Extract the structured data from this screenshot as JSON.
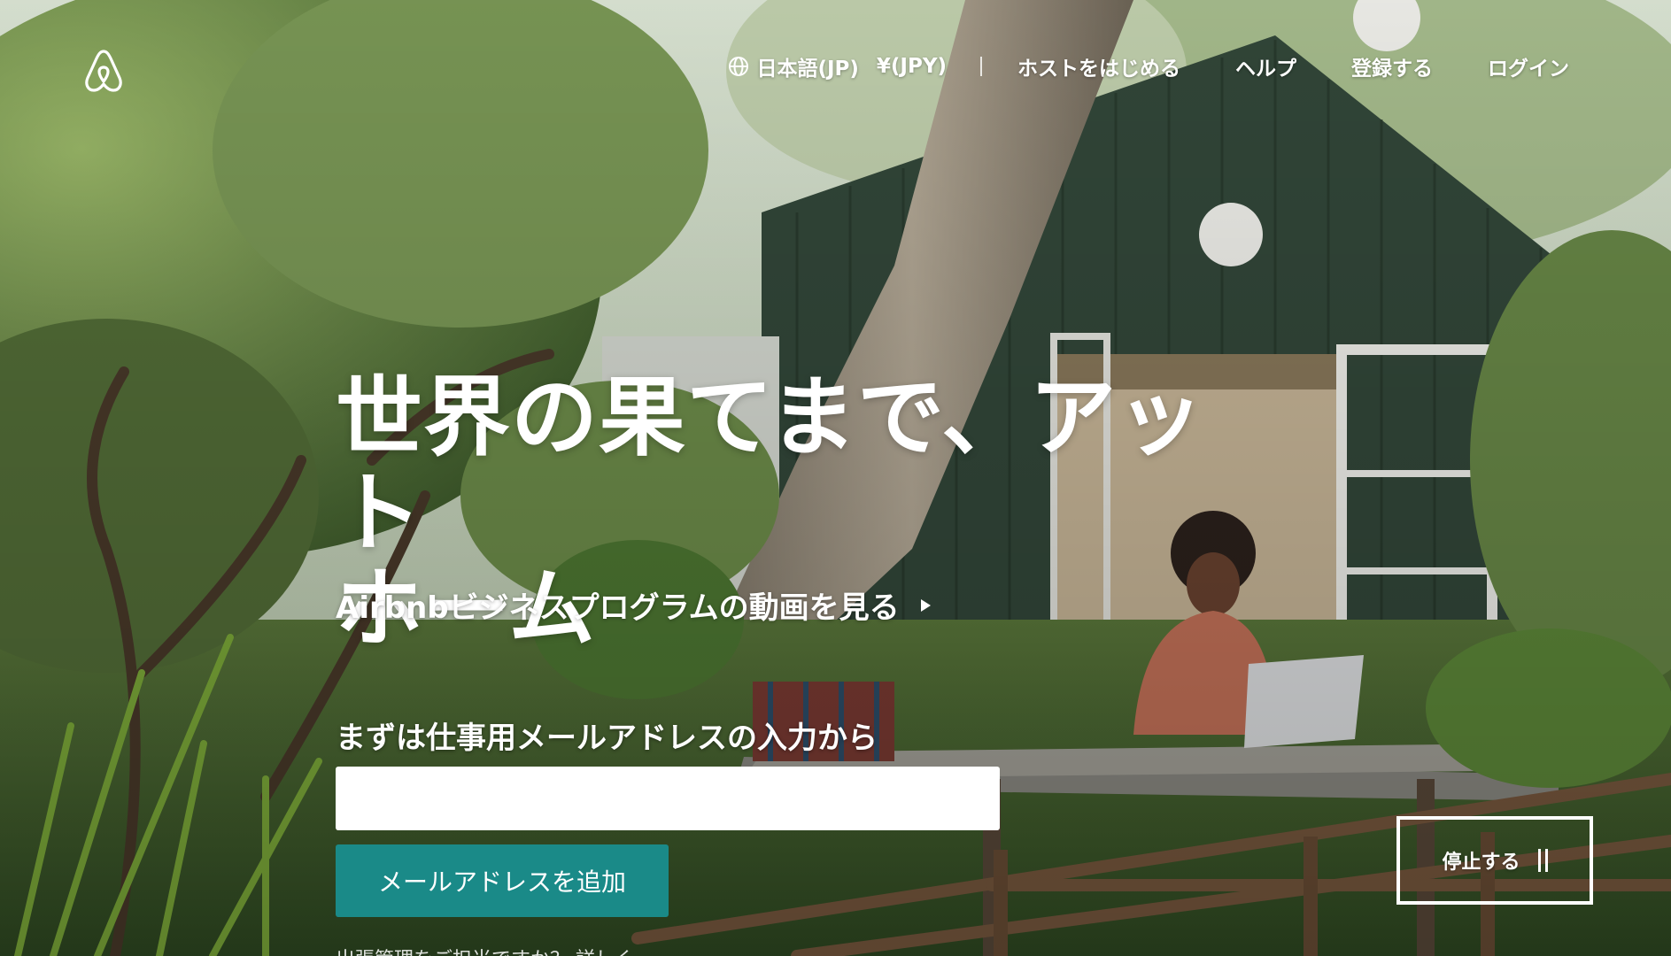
{
  "nav": {
    "language": "日本語(JP)",
    "currency": "¥(JPY)",
    "host": "ホストをはじめる",
    "help": "ヘルプ",
    "signup": "登録する",
    "login": "ログイン"
  },
  "hero": {
    "title_line1": "世界の果てまで、アット",
    "title_line2": "ホーム",
    "video_link": "Airbnbビジネスプログラムの動画を見る"
  },
  "signup_form": {
    "label": "まずは仕事用メールアドレスの入力から",
    "email_value": "",
    "email_placeholder": "",
    "submit_label": "メールアドレスを追加",
    "fine_print": "出張管理をご担当ですか？ 詳しく"
  },
  "video_controls": {
    "stop_label": "停止する"
  },
  "colors": {
    "button_teal": "#1a8a88",
    "text": "#ffffff"
  },
  "icons": {
    "logo": "airbnb-logo",
    "language": "globe-icon",
    "video": "play-triangle-icon",
    "stop": "pause-icon"
  }
}
